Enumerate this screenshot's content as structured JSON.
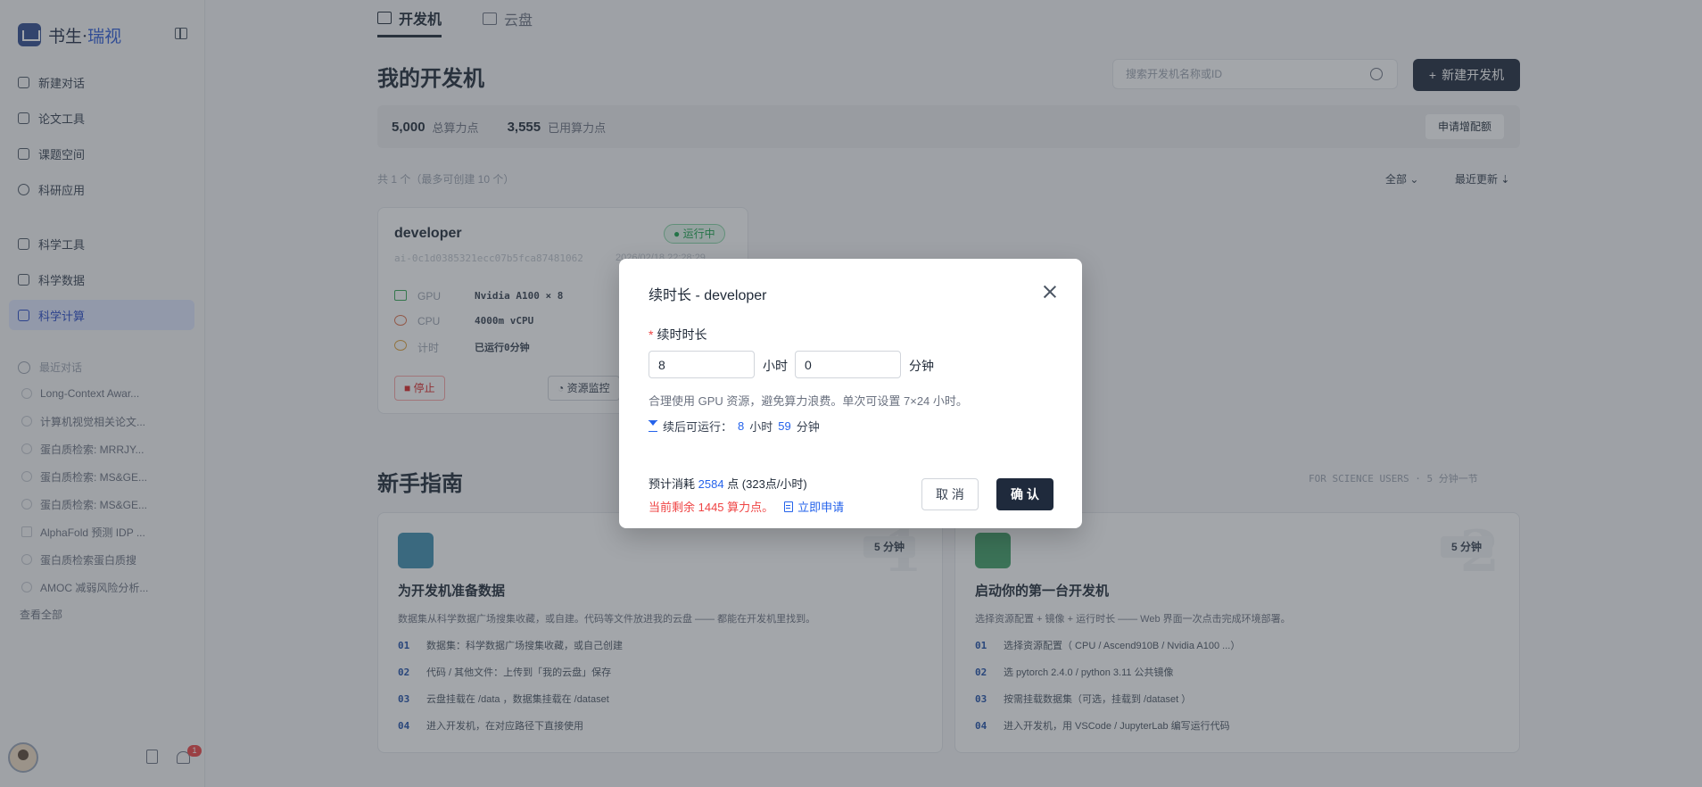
{
  "colors": {
    "accent": "#2563eb",
    "primary_button": "#1f2a3c",
    "danger": "#ef4444",
    "success": "#16a34a"
  },
  "sidebar": {
    "brand": {
      "name": "书生",
      "separator": "·",
      "sub": "瑞视"
    },
    "items": [
      {
        "label": "新建对话",
        "icon": "chat-plus-icon"
      },
      {
        "label": "论文工具",
        "icon": "paper-icon"
      },
      {
        "label": "课题空间",
        "icon": "workspace-icon"
      },
      {
        "label": "科研应用",
        "icon": "app-icon"
      },
      {
        "label": "科学工具",
        "icon": "tool-icon"
      },
      {
        "label": "科学数据",
        "icon": "database-icon"
      },
      {
        "label": "科学计算",
        "icon": "monitor-icon",
        "active": true
      }
    ],
    "history_title": "最近对话",
    "history": [
      "Long-Context Awar...",
      "计算机视觉相关论文...",
      "蛋白质检索: MRRJY...",
      "蛋白质检索: MS&GE...",
      "蛋白质检索: MS&GE...",
      "AlphaFold 预测 IDP ...",
      "蛋白质检索蛋白质搜",
      "AMOC 减弱风险分析..."
    ],
    "view_all": "查看全部",
    "notif_count": "1"
  },
  "main": {
    "tabs": [
      {
        "label": "开发机",
        "active": true
      },
      {
        "label": "云盘",
        "active": false
      }
    ],
    "page_title": "我的开发机",
    "search_placeholder": "搜索开发机名称或ID",
    "new_button": "新建开发机",
    "points": {
      "total": "5,000",
      "total_label": "总算力点",
      "used": "3,555",
      "used_label": "已用算力点",
      "apply_button": "申请增配额"
    },
    "count_text": "共 1 个（最多可创建 10 个）",
    "filter_label": "全部",
    "sort_label": "最近更新",
    "dev_card": {
      "name": "developer",
      "status": "运行中",
      "id": "ai-0c1d0385321ecc07b5fca87481062",
      "created": "2026/02/18 22:28:29",
      "specs": [
        {
          "label": "GPU",
          "value": "Nvidia A100 × 8"
        },
        {
          "label": "CPU",
          "value": "4000m vCPU"
        },
        {
          "label": "计时",
          "value": "已运行0分钟"
        }
      ],
      "stop_button": "停止",
      "monitor_button": "资源监控"
    },
    "guide": {
      "title": "新手指南",
      "meta": "FOR SCIENCE USERS · 5 分钟一节",
      "cards": [
        {
          "time": "5 分钟",
          "num": "1",
          "title": "为开发机准备数据",
          "desc": "数据集从科学数据广场搜集收藏，或自建。代码等文件放进我的云盘 —— 都能在开发机里找到。",
          "steps": [
            "数据集：科学数据广场搜集收藏，或自己创建",
            "代码 / 其他文件：上传到「我的云盘」保存",
            "云盘挂载在 /data ，数据集挂载在 /dataset"
          ],
          "step4": "进入开发机，在对应路径下直接使用"
        },
        {
          "time": "5 分钟",
          "num": "2",
          "title": "启动你的第一台开发机",
          "desc": "选择资源配置 + 镜像 + 运行时长 —— Web 界面一次点击完成环境部署。",
          "steps": [
            "选择资源配置（ CPU / Ascend910B / Nvidia A100 ...）",
            "选 pytorch 2.4.0 / python 3.11 公共镜像",
            "按需挂载数据集（可选，挂载到 /dataset ）"
          ],
          "step4": "进入开发机，用 VSCode / JupyterLab 编写运行代码"
        }
      ]
    }
  },
  "modal": {
    "title": "续时长 - developer",
    "field_label": "续时时长",
    "hours_value": "8",
    "hours_unit": "小时",
    "minutes_value": "0",
    "minutes_unit": "分钟",
    "hint": "合理使用 GPU 资源，避免算力浪费。单次可设置 7×24 小时。",
    "after_run_label": "续后可运行：",
    "after_hours": "8",
    "after_hours_unit": "小时",
    "after_minutes": "59",
    "after_minutes_unit": "分钟",
    "cost_prefix": "预计消耗",
    "cost_value": "2584",
    "cost_suffix": "点 (323点/小时)",
    "remain_text": "当前剩余 1445 算力点。",
    "apply_link": "立即申请",
    "cancel": "取 消",
    "confirm": "确 认"
  }
}
